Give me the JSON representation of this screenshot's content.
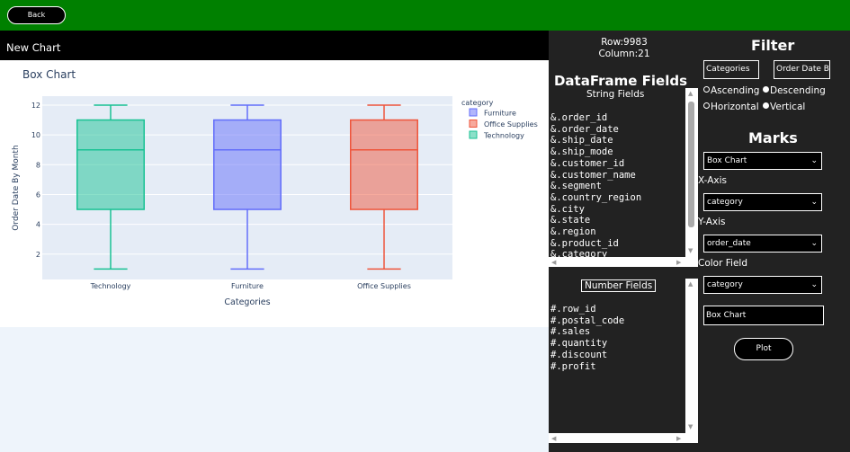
{
  "topbar": {
    "back_label": "Back",
    "color": "#008000"
  },
  "header": {
    "title": "New Chart"
  },
  "chart_data": {
    "type": "box",
    "title": "Box Chart",
    "xlabel": "Categories",
    "ylabel": "Order Date By Month",
    "categories": [
      "Technology",
      "Furniture",
      "Office Supplies"
    ],
    "yticks": [
      2,
      4,
      6,
      8,
      10,
      12
    ],
    "ylim": [
      0.3,
      12.6
    ],
    "series": [
      {
        "category": "Technology",
        "min": 1,
        "q1": 5,
        "median": 9,
        "q3": 11,
        "max": 12,
        "color": "#19c293"
      },
      {
        "category": "Furniture",
        "min": 1,
        "q1": 5,
        "median": 9,
        "q3": 11,
        "max": 12,
        "color": "#636efa"
      },
      {
        "category": "Office Supplies",
        "min": 1,
        "q1": 5,
        "median": 9,
        "q3": 11,
        "max": 12,
        "color": "#ef553b"
      }
    ],
    "legend": {
      "title": "category",
      "position": "top-right",
      "items": [
        {
          "label": "Furniture",
          "color": "#636efa"
        },
        {
          "label": "Office Supplies",
          "color": "#ef553b"
        },
        {
          "label": "Technology",
          "color": "#19c293"
        }
      ]
    },
    "grid": true
  },
  "panel": {
    "row_info": "Row:9983",
    "col_info": "Column:21",
    "df_title": "DataFrame Fields",
    "string_fields_label": "String Fields",
    "string_fields": [
      "&.order_id",
      "&.order_date",
      "&.ship_date",
      "&.ship_mode",
      "&.customer_id",
      "&.customer_name",
      "&.segment",
      "&.country_region",
      "&.city",
      "&.state",
      "&.region",
      "&.product_id",
      "&.category"
    ],
    "number_fields_label": "Number Fields",
    "number_fields": [
      "#.row_id",
      "#.postal_code",
      "#.sales",
      "#.quantity",
      "#.discount",
      "#.profit"
    ],
    "filter": {
      "title": "Filter",
      "field1": "Categories",
      "field2": "Order Date By",
      "ascending": "Ascending",
      "descending": "Descending",
      "horizontal": "Horizontal",
      "vertical": "Vertical"
    },
    "marks": {
      "title": "Marks",
      "chart_type": "Box Chart",
      "x_axis_label": "X-Axis",
      "x_axis_value": "category",
      "y_axis_label": "Y-Axis",
      "y_axis_value": "order_date",
      "color_field_label": "Color Field",
      "color_field_value": "category",
      "chart_name": "Box Chart",
      "plot_label": "Plot"
    }
  }
}
